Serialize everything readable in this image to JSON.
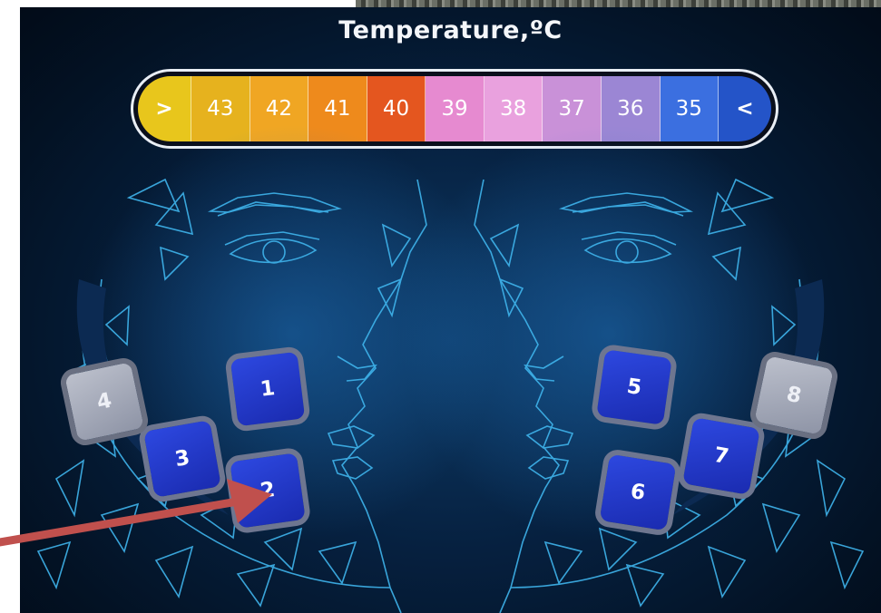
{
  "title": "Temperature,ºC",
  "scale": {
    "cells": [
      {
        "label": ">",
        "color": "#e8c61c"
      },
      {
        "label": "43",
        "color": "#e6b21e"
      },
      {
        "label": "42",
        "color": "#f0a623"
      },
      {
        "label": "41",
        "color": "#ee8a1c"
      },
      {
        "label": "40",
        "color": "#e4561f"
      },
      {
        "label": "39",
        "color": "#e68ad0"
      },
      {
        "label": "38",
        "color": "#e9a1de"
      },
      {
        "label": "37",
        "color": "#c991d8"
      },
      {
        "label": "36",
        "color": "#9b86d4"
      },
      {
        "label": "35",
        "color": "#3b6fe0"
      },
      {
        "label": "<",
        "color": "#2454c8"
      }
    ]
  },
  "zones": [
    {
      "label": "1",
      "state": "active"
    },
    {
      "label": "2",
      "state": "active"
    },
    {
      "label": "3",
      "state": "active"
    },
    {
      "label": "4",
      "state": "inactive"
    },
    {
      "label": "5",
      "state": "active"
    },
    {
      "label": "6",
      "state": "active"
    },
    {
      "label": "7",
      "state": "active"
    },
    {
      "label": "8",
      "state": "inactive"
    }
  ],
  "colors": {
    "annotation_arrow": "#c0504d",
    "face_line": "#3fb4ec"
  }
}
